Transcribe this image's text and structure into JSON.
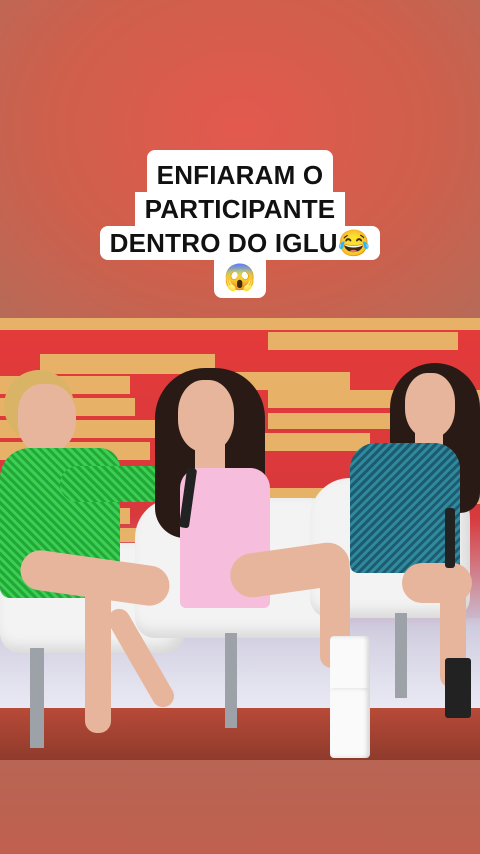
{
  "caption": {
    "line1": "ENFIARAM O",
    "line2": "PARTICIPANTE",
    "line3": "DENTRO DO IGLU😂",
    "line4": "😱"
  },
  "colors": {
    "caption_bg": "#ffffff",
    "caption_text": "#111111",
    "studio_red": "#e43a3a",
    "accent_gold": "#e7b86a"
  }
}
